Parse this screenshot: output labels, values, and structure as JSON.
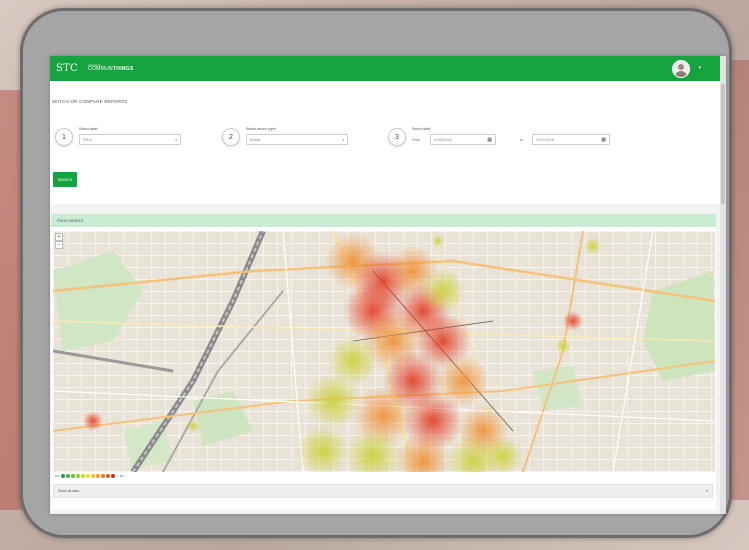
{
  "topbar": {
    "logo": "STC",
    "brand_small": "powered by",
    "brand_regular": "COMMUN",
    "brand_bold": "THINGS",
    "caret": "▾"
  },
  "page": {
    "heading": "WATCH OR COMPARE REPORTS"
  },
  "steps": [
    {
      "number": "1",
      "label": "Select data*",
      "value": "PM10",
      "arrow": "▾"
    },
    {
      "number": "2",
      "label": "Select sensor type*",
      "value": "Mobile",
      "arrow": "▾"
    },
    {
      "number": "3",
      "label": "Select date*",
      "from_label": "From",
      "from_value": "01/05/2018",
      "to_label": "to",
      "to_value": "17/10/2018",
      "calendar": "▦"
    }
  ],
  "search_label": "SEARCH",
  "map": {
    "header": "PM10 MOBILE",
    "zoom_in": "+",
    "zoom_out": "−",
    "legend_low": "0-5",
    "legend_high": "> 60",
    "legend_colors": [
      "#1a9c3c",
      "#3fb23a",
      "#68c032",
      "#98cd2c",
      "#c6d82a",
      "#e8dc27",
      "#f2bb23",
      "#f39a20",
      "#ef7720",
      "#e9521f",
      "#d8261d"
    ],
    "show_all_label": "Show all data",
    "show_all_arrow": "▾"
  }
}
